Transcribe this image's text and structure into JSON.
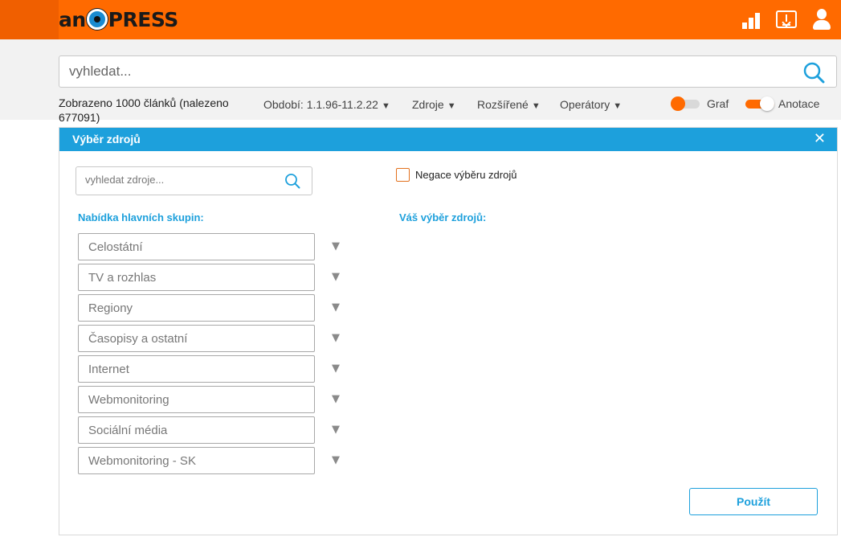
{
  "header": {
    "logo_left": "an",
    "logo_right": "PRESS",
    "icons": [
      "stats-bars-icon",
      "download-icon",
      "user-icon"
    ],
    "brand_color": "#ff6a00"
  },
  "search": {
    "placeholder": "vyhledat..."
  },
  "filter_bar": {
    "results_text": "Zobrazeno 1000 článků (nalezeno 677091)",
    "period_label": "Období: 1.1.96-11.2.22",
    "sources_label": "Zdroje",
    "advanced_label": "Rozšířené",
    "operators_label": "Operátory",
    "graph_label": "Graf",
    "annotation_label": "Anotace",
    "graph_enabled": false,
    "annotation_enabled": true
  },
  "modal": {
    "title": "Výběr zdrojů",
    "close_glyph": "✕",
    "source_search_placeholder": "vyhledat zdroje...",
    "negation_label": "Negace výběru zdrojů",
    "negation_checked": false,
    "main_groups_title": "Nabídka hlavních skupin:",
    "selection_title": "Váš výběr zdrojů:",
    "groups": [
      "Celostátní",
      "TV a rozhlas",
      "Regiony",
      "Časopisy a ostatní",
      "Internet",
      "Webmonitoring",
      "Sociální média",
      "Webmonitoring - SK"
    ],
    "apply_label": "Použít",
    "accent_color": "#1da0dc"
  }
}
